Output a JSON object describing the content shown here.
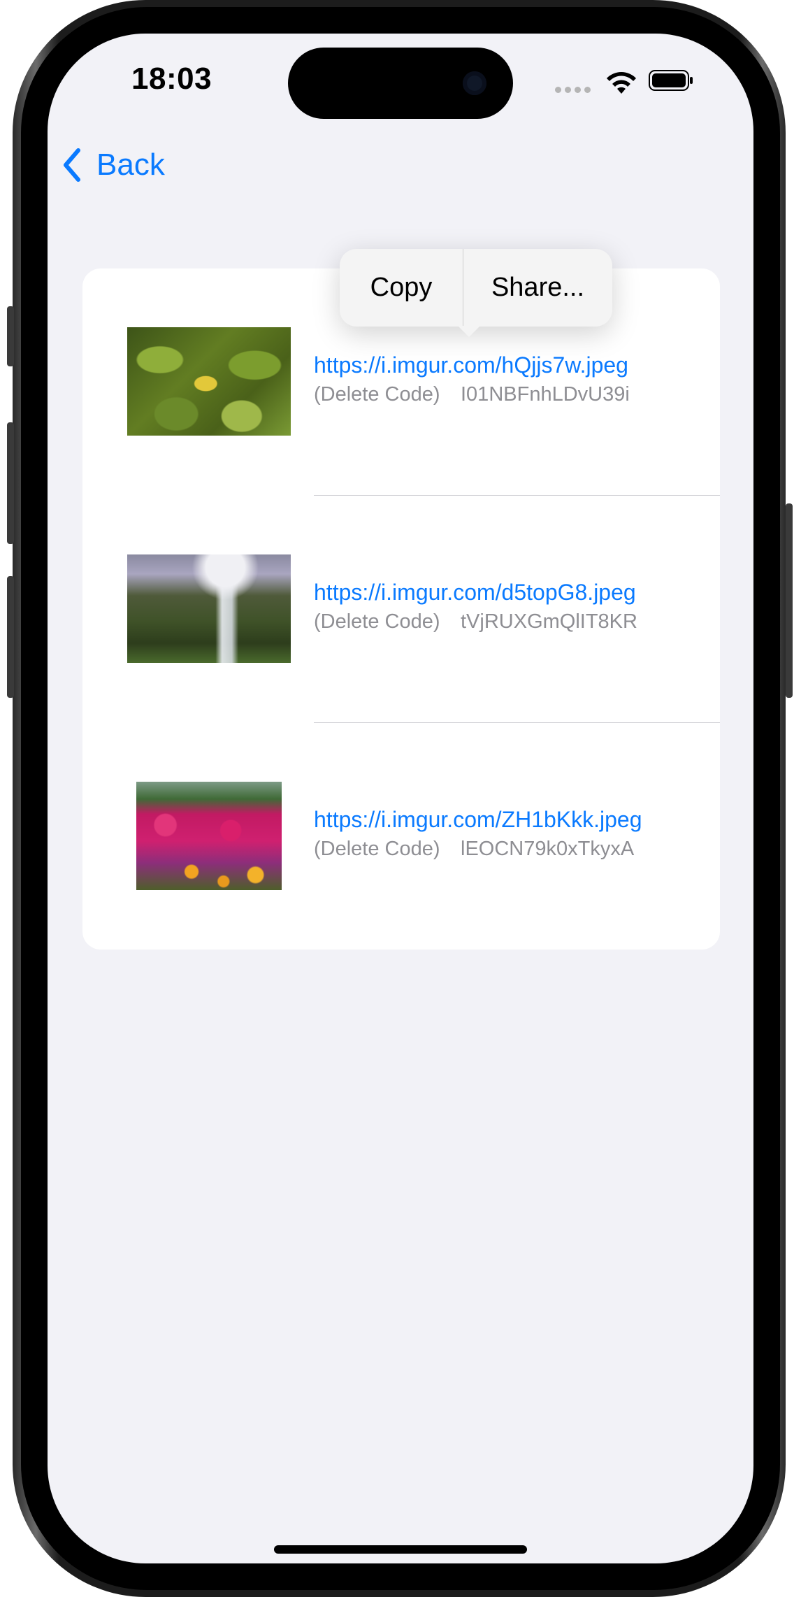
{
  "status_bar": {
    "time": "18:03"
  },
  "nav": {
    "back_label": "Back"
  },
  "context_menu": {
    "items": [
      "Copy",
      "Share..."
    ]
  },
  "uploads": [
    {
      "url": "https://i.imgur.com/hQjjs7w.jpeg",
      "delete_label": "(Delete Code)",
      "delete_code": "I01NBFnhLDvU39i",
      "thumbnail": "leaves-photo"
    },
    {
      "url": "https://i.imgur.com/d5topG8.jpeg",
      "delete_label": "(Delete Code)",
      "delete_code": "tVjRUXGmQlIT8KR",
      "thumbnail": "waterfall-photo"
    },
    {
      "url": "https://i.imgur.com/ZH1bKkk.jpeg",
      "delete_label": "(Delete Code)",
      "delete_code": "lEOCN79k0xTkyxA",
      "thumbnail": "flowers-photo"
    }
  ],
  "colors": {
    "accent": "#0a7aff",
    "secondary_text": "#8e8e93",
    "background": "#f2f2f7"
  }
}
